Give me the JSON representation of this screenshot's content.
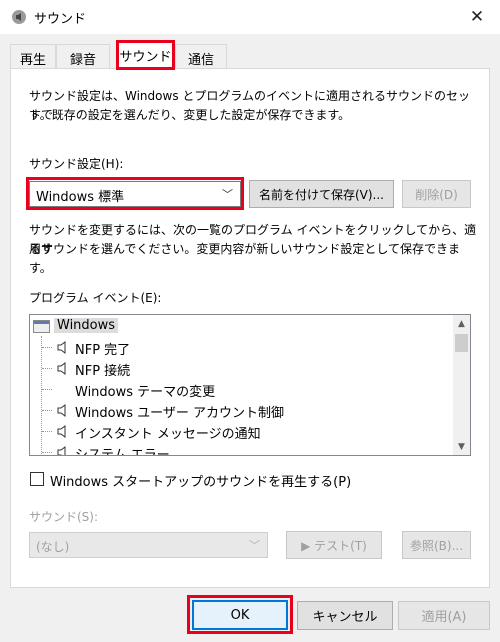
{
  "window": {
    "title": "サウンド",
    "close_glyph": "✕"
  },
  "tabs": [
    {
      "label": "再生"
    },
    {
      "label": "録音"
    },
    {
      "label": "サウンド",
      "active": true
    },
    {
      "label": "通信"
    }
  ],
  "description": {
    "line1": "サウンド設定は、Windows とプログラムのイベントに適用されるサウンドのセットで",
    "line2": "す。既存の設定を選んだり、変更した設定が保存できます。"
  },
  "scheme": {
    "label": "サウンド設定(H):",
    "selected": "Windows 標準",
    "save_as_label": "名前を付けて保存(V)...",
    "delete_label": "削除(D)"
  },
  "instructions": {
    "line1": "サウンドを変更するには、次の一覧のプログラム イベントをクリックしてから、適用す",
    "line2": "るサウンドを選んでください。変更内容が新しいサウンド設定として保存できます。"
  },
  "events": {
    "label": "プログラム イベント(E):",
    "items": [
      {
        "label": "Windows",
        "icon": "window-icon",
        "root": true
      },
      {
        "label": "NFP 完了",
        "icon": "speaker-icon"
      },
      {
        "label": "NFP 接続",
        "icon": "speaker-icon"
      },
      {
        "label": "Windows テーマの変更",
        "icon": "none"
      },
      {
        "label": "Windows ユーザー アカウント制御",
        "icon": "speaker-icon"
      },
      {
        "label": "インスタント メッセージの通知",
        "icon": "speaker-icon"
      },
      {
        "label": "システム エラー",
        "icon": "speaker-icon"
      }
    ]
  },
  "startup_checkbox": {
    "label": "Windows スタートアップのサウンドを再生する(P)",
    "checked": false
  },
  "sounds": {
    "label": "サウンド(S):",
    "selected": "(なし)",
    "test_label": "▶ テスト(T)",
    "browse_label": "参照(B)..."
  },
  "footer": {
    "ok_label": "OK",
    "cancel_label": "キャンセル",
    "apply_label": "適用(A)"
  },
  "colors": {
    "highlight": "#e8001d",
    "ok_border": "#0078d7",
    "disabled_text": "#a0a0a0",
    "play_icon": "#3aa35a"
  }
}
